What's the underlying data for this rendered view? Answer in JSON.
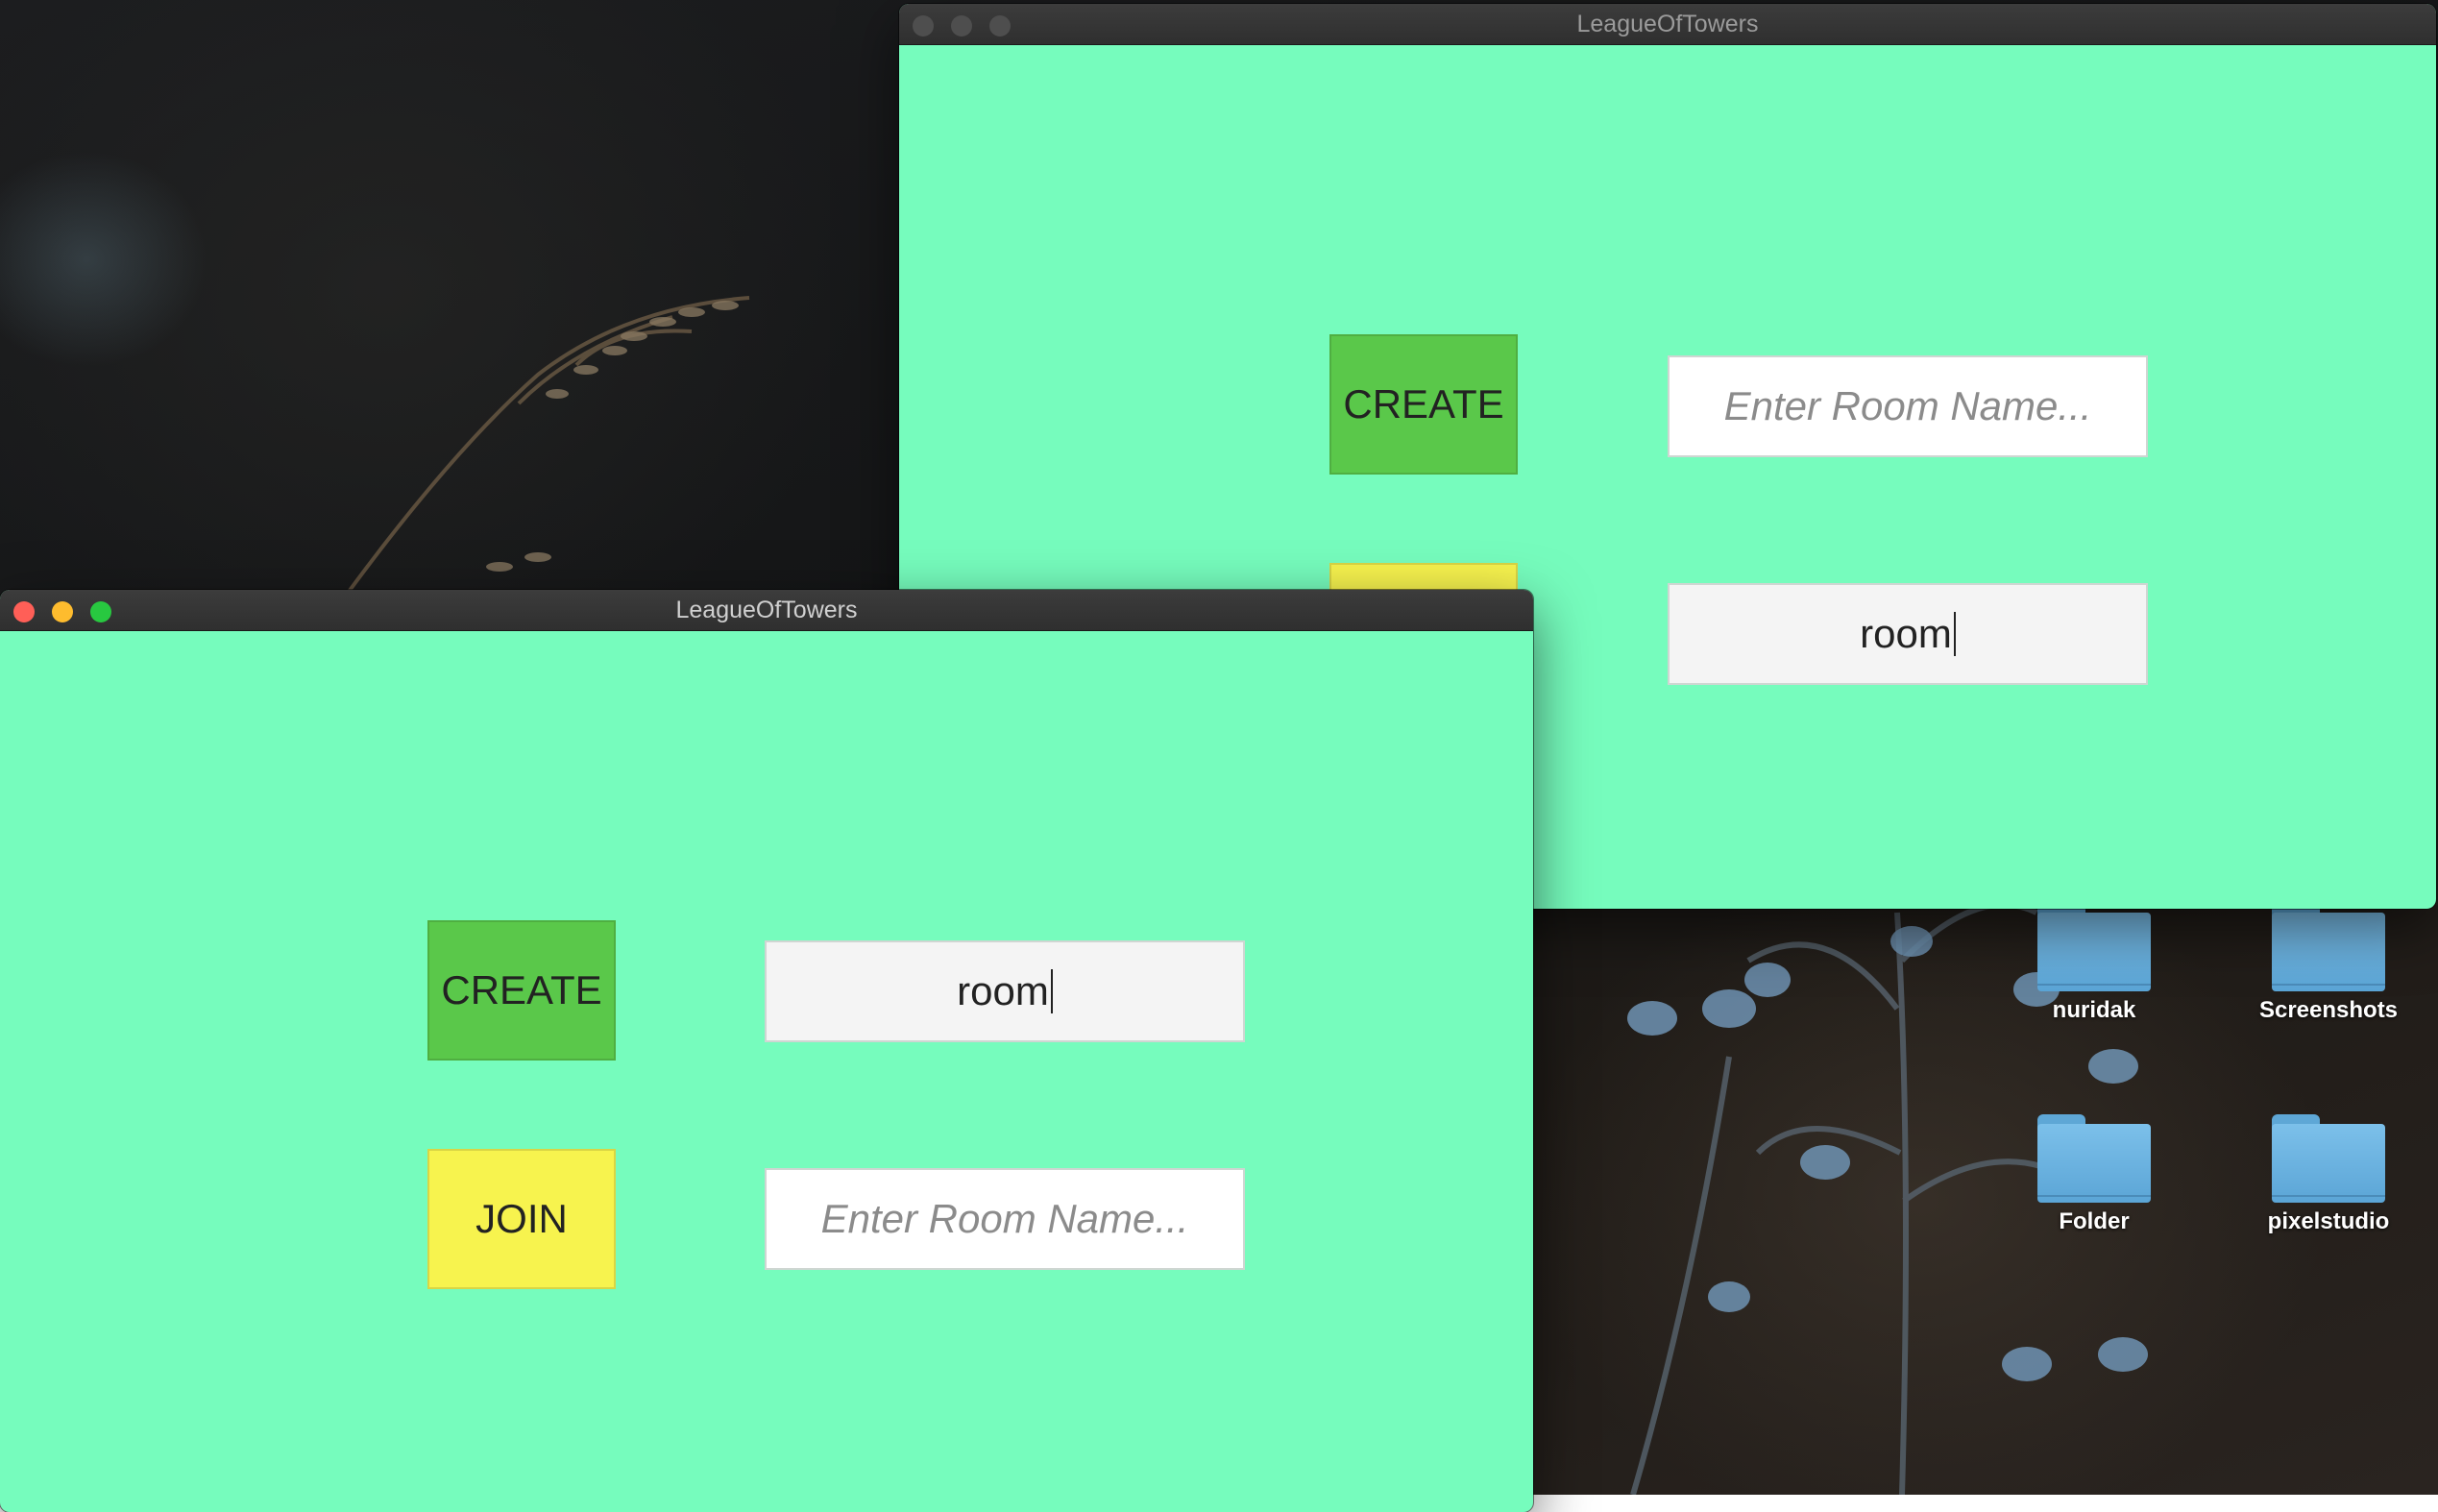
{
  "desktop": {
    "items": [
      {
        "label": "nuridak",
        "icon": "folder-icon"
      },
      {
        "label": "Screenshots",
        "icon": "folder-icon"
      },
      {
        "label": "Folder",
        "icon": "folder-icon"
      },
      {
        "label": "pixelstudio",
        "icon": "folder-icon"
      }
    ]
  },
  "windows": {
    "back": {
      "title": "LeagueOfTowers",
      "create_label": "CREATE",
      "create_field_placeholder": "Enter Room Name...",
      "join_field_value": "room"
    },
    "front": {
      "title": "LeagueOfTowers",
      "create_label": "CREATE",
      "join_label": "JOIN",
      "create_field_value": "room",
      "join_field_placeholder": "Enter Room Name..."
    }
  },
  "colors": {
    "window_bg": "#76fcbd",
    "create_button": "#5ac84a",
    "join_button": "#f7f34e",
    "close_light": "#ff5f57",
    "minimize_light": "#febc2e",
    "zoom_light": "#28c840"
  }
}
